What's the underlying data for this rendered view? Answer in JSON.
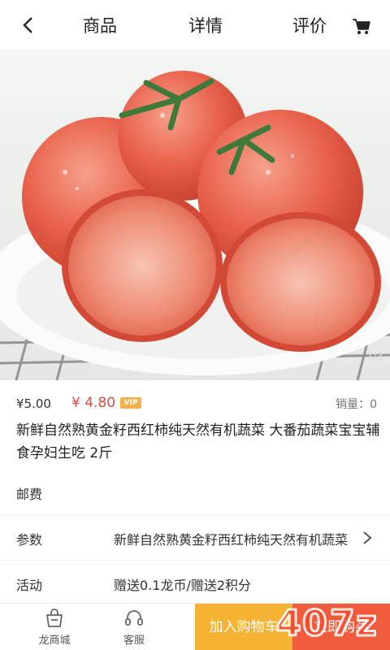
{
  "header": {
    "tabs": [
      "商品",
      "详情",
      "评价"
    ],
    "icons": {
      "back": "back-arrow-icon",
      "cart": "shopping-cart-icon"
    }
  },
  "gallery": {
    "pager": "1/3",
    "image": "fresh-tomatoes-on-plate"
  },
  "product": {
    "price": "¥5.00",
    "vip_price": "¥ 4.80",
    "vip_badge": "VIP",
    "sales": "销量：0",
    "title": "新鲜自然熟黄金籽西红柿纯天然有机蔬菜 大番茄蔬菜宝宝辅食孕妇生吃 2斤"
  },
  "details": [
    {
      "label": "邮费",
      "value": ""
    },
    {
      "label": "参数",
      "value": "新鲜自然熟黄金籽西红柿纯天然有机蔬菜"
    },
    {
      "label": "活动",
      "value": "赠送0.1龙币/赠送2积分"
    }
  ],
  "bottom_bar": {
    "shop_label": "龙商城",
    "service_label": "客服",
    "add_to_cart": "加入购物车",
    "buy_now": "立即购买"
  },
  "colors": {
    "accent_price": "#e04b3b",
    "cart_button": "#f6b333",
    "buy_button": "#f05a3d"
  }
}
